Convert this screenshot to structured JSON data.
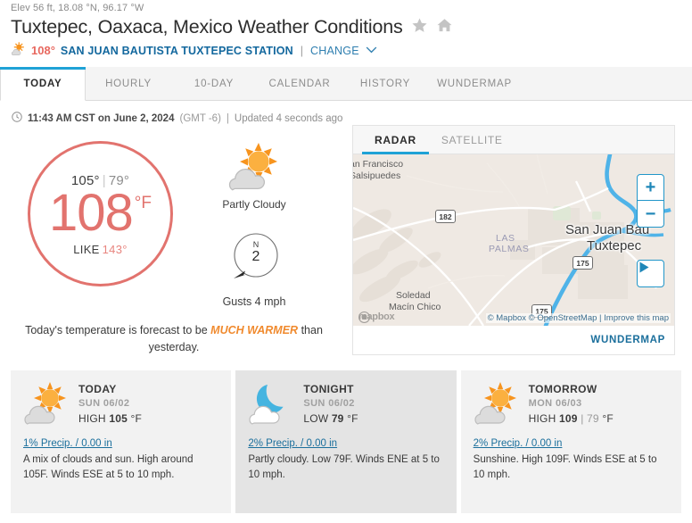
{
  "header": {
    "elevation": "Elev 56 ft, 18.08 °N, 96.17 °W",
    "title": "Tuxtepec, Oaxaca, Mexico Weather Conditions",
    "star_icon": "star-icon",
    "home_icon": "home-icon",
    "station_temp": "108°",
    "station_name": "SAN JUAN BAUTISTA TUXTEPEC STATION",
    "separator": "|",
    "change_label": "CHANGE",
    "station_icon": "partly-cloudy-small-icon"
  },
  "tabs": [
    {
      "label": "TODAY",
      "active": true
    },
    {
      "label": "HOURLY",
      "active": false
    },
    {
      "label": "10-DAY",
      "active": false
    },
    {
      "label": "CALENDAR",
      "active": false
    },
    {
      "label": "HISTORY",
      "active": false
    },
    {
      "label": "WUNDERMAP",
      "active": false
    }
  ],
  "timestamp": {
    "clock_icon": "clock-icon",
    "main": "11:43 AM CST on June 2, 2024",
    "gmt": "(GMT -6)",
    "divider": "|",
    "updated": "Updated 4 seconds ago"
  },
  "current": {
    "high": "105°",
    "separator": "|",
    "low": "79°",
    "temp": "108",
    "unit": "°F",
    "like_label": "LIKE",
    "like_value": "143°",
    "condition_icon": "partly-cloudy-icon",
    "condition_label": "Partly Cloudy",
    "wind_dir_label": "N",
    "wind_speed": "2",
    "wind_arrow_icon": "wind-direction-arrow-icon",
    "gusts": "Gusts 4 mph",
    "forecast_prefix": "Today's temperature is forecast to be",
    "forecast_emphasis": "MUCH WARMER",
    "forecast_suffix": "than yesterday."
  },
  "radar": {
    "tabs": [
      {
        "label": "RADAR",
        "active": true
      },
      {
        "label": "SATELLITE",
        "active": false
      }
    ],
    "map_labels": [
      {
        "text": "an Francisco",
        "type": "place"
      },
      {
        "text": "Salsipuedes",
        "type": "place"
      },
      {
        "text": "LAS",
        "type": "area"
      },
      {
        "text": "PALMAS",
        "type": "area"
      },
      {
        "text": "Soledad",
        "type": "place"
      },
      {
        "text": "Macín Chico",
        "type": "place"
      },
      {
        "text": "San Juan Bau",
        "type": "city"
      },
      {
        "text": "Tuxtepec",
        "type": "city"
      }
    ],
    "shields": [
      "182",
      "175",
      "175"
    ],
    "zoom_in": "+",
    "zoom_out": "−",
    "play_icon": "play-icon",
    "mapbox_logo_text": "mapbox",
    "attribution": "© Mapbox © OpenStreetMap | Improve this map",
    "wundermap_label": "WUNDERMAP"
  },
  "cards": [
    {
      "when": "TODAY",
      "date": "SUN 06/02",
      "temp_label": "HIGH",
      "temp_value": "105",
      "temp_unit": "°F",
      "temp_alt": "",
      "precip": "1% Precip. / 0.00 in",
      "description": "A mix of clouds and sun. High around 105F. Winds ESE at 5 to 10 mph.",
      "icon": "sun-cloud-icon",
      "highlight": false
    },
    {
      "when": "TONIGHT",
      "date": "SUN 06/02",
      "temp_label": "LOW",
      "temp_value": "79",
      "temp_unit": "°F",
      "temp_alt": "",
      "precip": "2% Precip. / 0.00 in",
      "description": "Partly cloudy. Low 79F. Winds ENE at 5 to 10 mph.",
      "icon": "moon-cloud-icon",
      "highlight": true
    },
    {
      "when": "TOMORROW",
      "date": "MON 06/03",
      "temp_label": "HIGH",
      "temp_value": "109",
      "temp_unit": "°F",
      "temp_alt": "| 79",
      "precip": "2% Precip. / 0.00 in",
      "description": "Sunshine. High 109F. Winds ESE at 5 to 10 mph.",
      "icon": "sun-cloud-icon",
      "highlight": false
    }
  ],
  "colors": {
    "accent_blue": "#1fa2d6",
    "link_blue": "#1b6f9c",
    "temp_red": "#e2736e",
    "warm_orange": "#f08a2e",
    "sun_orange": "#f7941e",
    "moon_blue": "#45b4e0"
  }
}
